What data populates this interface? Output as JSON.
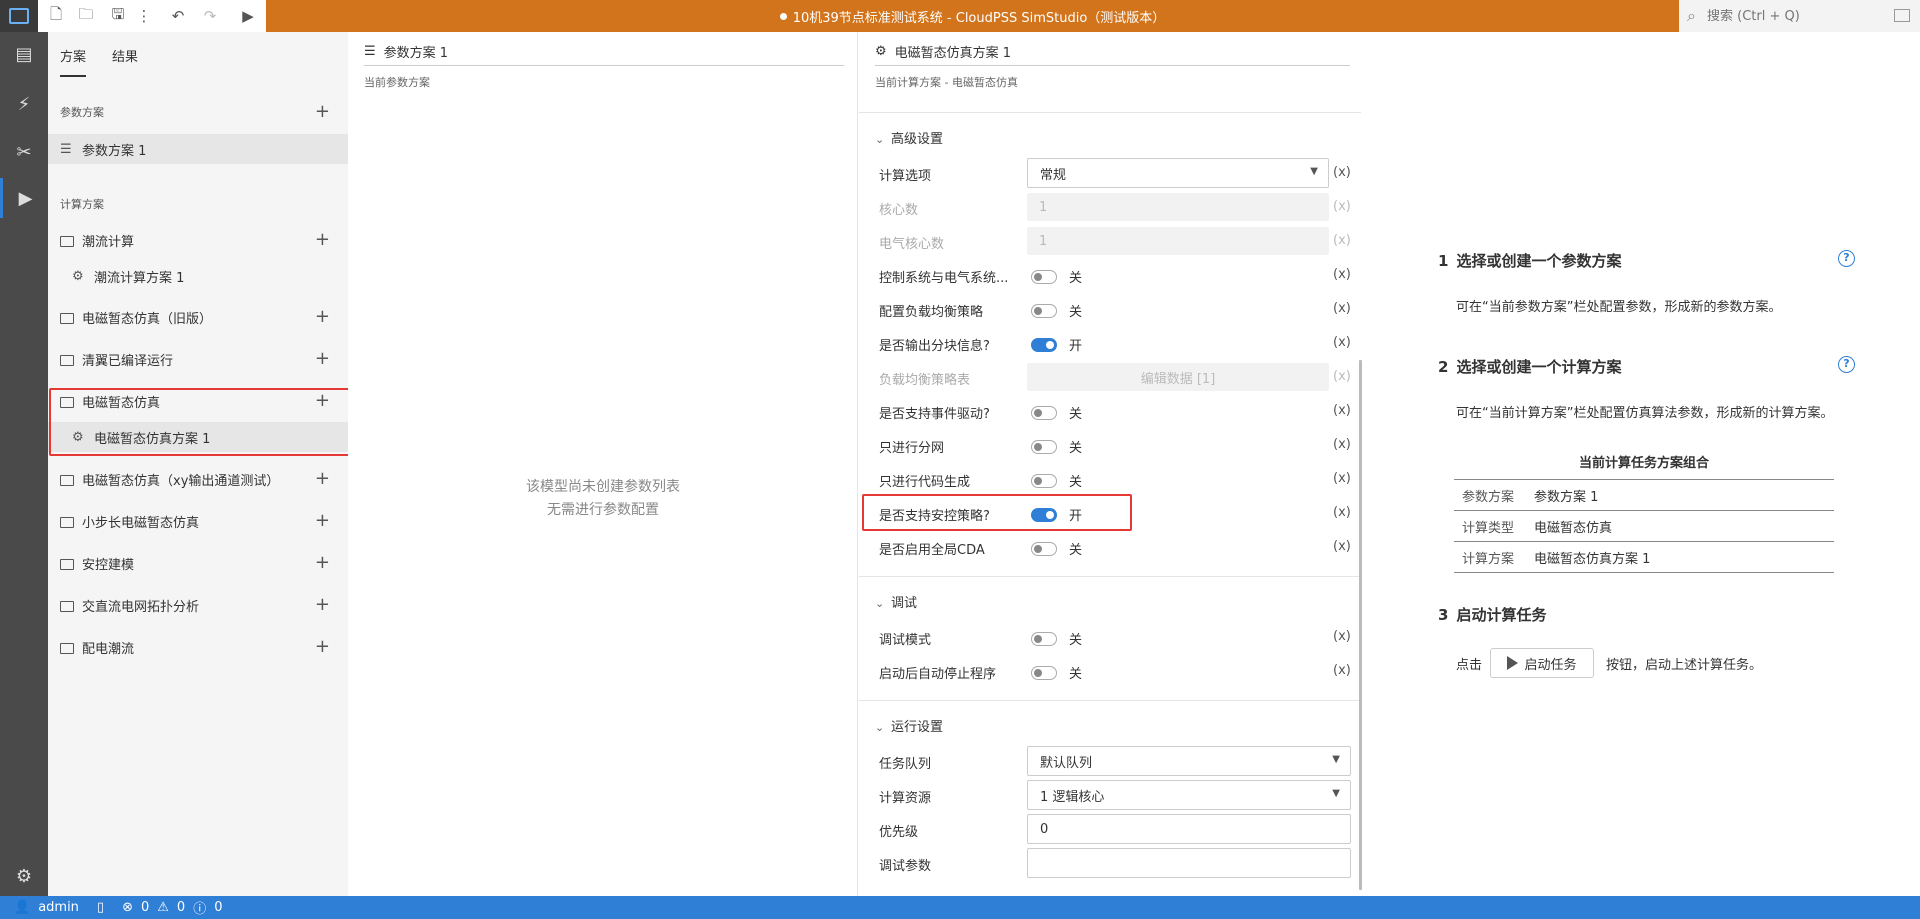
{
  "app": {
    "title": "10机39节点标准测试系统 - CloudPSS SimStudio（测试版本）",
    "search_placeholder": "搜索 (Ctrl + Q)"
  },
  "toolbar": {
    "icons": [
      "new-file-icon",
      "open-folder-icon",
      "save-icon",
      "more-icon",
      "undo-icon",
      "redo-icon",
      "run-icon"
    ]
  },
  "rail": {
    "items": [
      "overview-icon",
      "plugin-icon",
      "tools-icon",
      "simulation-icon"
    ],
    "settings": "settings-icon"
  },
  "left_panel": {
    "tabs": [
      "方案",
      "结果"
    ],
    "param_section": "参数方案",
    "param_items": [
      "参数方案 1"
    ],
    "calc_section": "计算方案",
    "calc_groups": [
      {
        "label": "潮流计算",
        "children": [
          "潮流计算方案 1"
        ]
      },
      {
        "label": "电磁暂态仿真（旧版）",
        "children": []
      },
      {
        "label": "清翼已编译运行",
        "children": []
      },
      {
        "label": "电磁暂态仿真",
        "children": [
          "电磁暂态仿真方案 1"
        ]
      },
      {
        "label": "电磁暂态仿真（xy输出通道测试）",
        "children": []
      },
      {
        "label": "小步长电磁暂态仿真",
        "children": []
      },
      {
        "label": "安控建模",
        "children": []
      },
      {
        "label": "交直流电网拓扑分析",
        "children": []
      },
      {
        "label": "配电潮流",
        "children": []
      }
    ]
  },
  "param_panel": {
    "title": "参数方案 1",
    "subtitle": "当前参数方案",
    "empty_line1": "该模型尚未创建参数列表",
    "empty_line2": "无需进行参数配置"
  },
  "calc_panel": {
    "title": "电磁暂态仿真方案 1",
    "subtitle": "当前计算方案 - 电磁暂态仿真",
    "advanced_title": "高级设置",
    "calc_option_label": "计算选项",
    "calc_option_value": "常规",
    "cores_label": "核心数",
    "cores_value": "1",
    "elec_cores_label": "电气核心数",
    "elec_cores_value": "1",
    "ctrl_sys_label": "控制系统与电气系统...",
    "ctrl_sys_value": "关",
    "balance_label": "配置负载均衡策略",
    "balance_value": "关",
    "block_label": "是否输出分块信息?",
    "block_value": "开",
    "balance_table_label": "负载均衡策略表",
    "balance_table_value": "编辑数据 [1]",
    "event_label": "是否支持事件驱动?",
    "event_value": "关",
    "partition_label": "只进行分网",
    "partition_value": "关",
    "codegen_label": "只进行代码生成",
    "codegen_value": "关",
    "security_label": "是否支持安控策略?",
    "security_value": "开",
    "cda_label": "是否启用全局CDA",
    "cda_value": "关",
    "debug_title": "调试",
    "debug_mode_label": "调试模式",
    "debug_mode_value": "关",
    "autostop_label": "启动后自动停止程序",
    "autostop_value": "关",
    "run_title": "运行设置",
    "queue_label": "任务队列",
    "queue_value": "默认队列",
    "resource_label": "计算资源",
    "resource_value": "1 逻辑核心",
    "priority_label": "优先级",
    "priority_value": "0",
    "debug_params_label": "调试参数",
    "debug_params_value": "",
    "x_marker": "(x)"
  },
  "guide": {
    "step1_num": "1",
    "step1_title": "选择或创建一个参数方案",
    "step1_text": "可在“当前参数方案”栏处配置参数，形成新的参数方案。",
    "step2_num": "2",
    "step2_title": "选择或创建一个计算方案",
    "step2_text": "可在“当前计算方案”栏处配置仿真算法参数，形成新的计算方案。",
    "combo_title": "当前计算任务方案组合",
    "combo_rows": [
      {
        "k": "参数方案",
        "v": "参数方案 1"
      },
      {
        "k": "计算类型",
        "v": "电磁暂态仿真"
      },
      {
        "k": "计算方案",
        "v": "电磁暂态仿真方案 1"
      }
    ],
    "step3_num": "3",
    "step3_title": "启动计算任务",
    "step3_pre": "点击",
    "step3_btn": "启动任务",
    "step3_post": "按钮，启动上述计算任务。"
  },
  "status": {
    "user": "admin",
    "errors": "0",
    "warnings": "0",
    "infos": "0"
  }
}
